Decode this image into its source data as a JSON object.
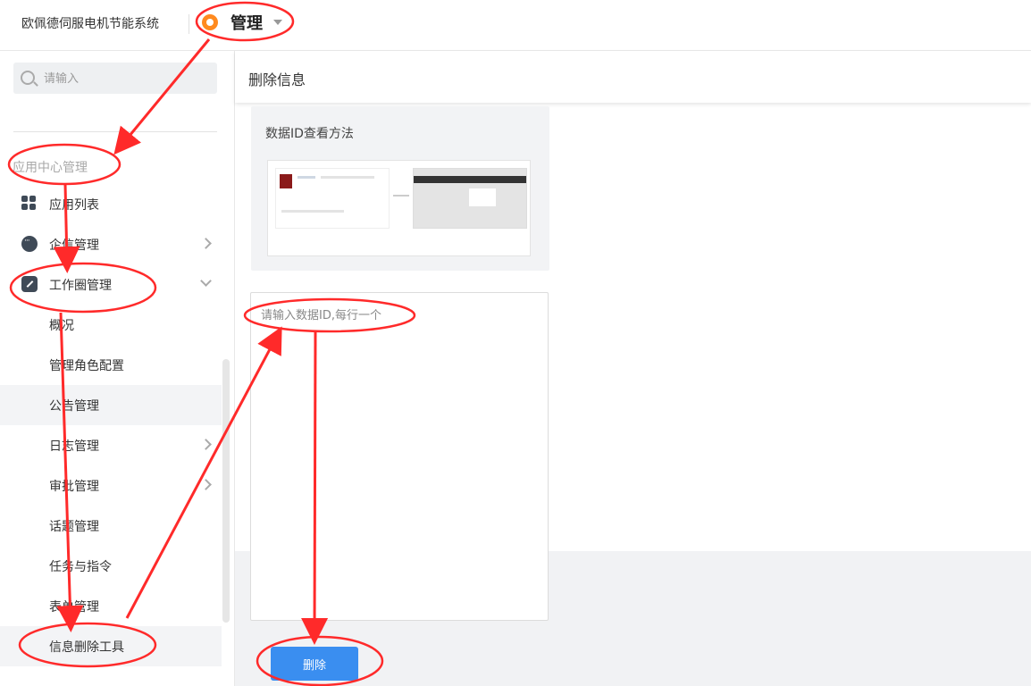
{
  "header": {
    "brand": "欧佩德伺服电机节能系统",
    "app_title": "管理"
  },
  "sidebar": {
    "search_placeholder": "请输入",
    "section_title": "应用中心管理",
    "items": [
      {
        "label": "应用列表",
        "icon": "apps-icon"
      },
      {
        "label": "企信管理",
        "icon": "chat-icon",
        "chevron": "right"
      },
      {
        "label": "工作圈管理",
        "icon": "edit-icon",
        "chevron": "down"
      },
      {
        "label": "概况"
      },
      {
        "label": "管理角色配置"
      },
      {
        "label": "公告管理"
      },
      {
        "label": "日志管理",
        "chevron": "right"
      },
      {
        "label": "审批管理",
        "chevron": "right"
      },
      {
        "label": "话题管理"
      },
      {
        "label": "任务与指令"
      },
      {
        "label": "表单管理"
      },
      {
        "label": "信息删除工具"
      }
    ]
  },
  "main": {
    "page_title": "删除信息",
    "help_title": "数据ID查看方法",
    "textarea_placeholder": "请输入数据ID,每行一个",
    "delete_label": "删除"
  },
  "colors": {
    "accent": "#3a8ef0",
    "annotation": "#ff2a2a",
    "app_icon": "#ff8a1f"
  }
}
